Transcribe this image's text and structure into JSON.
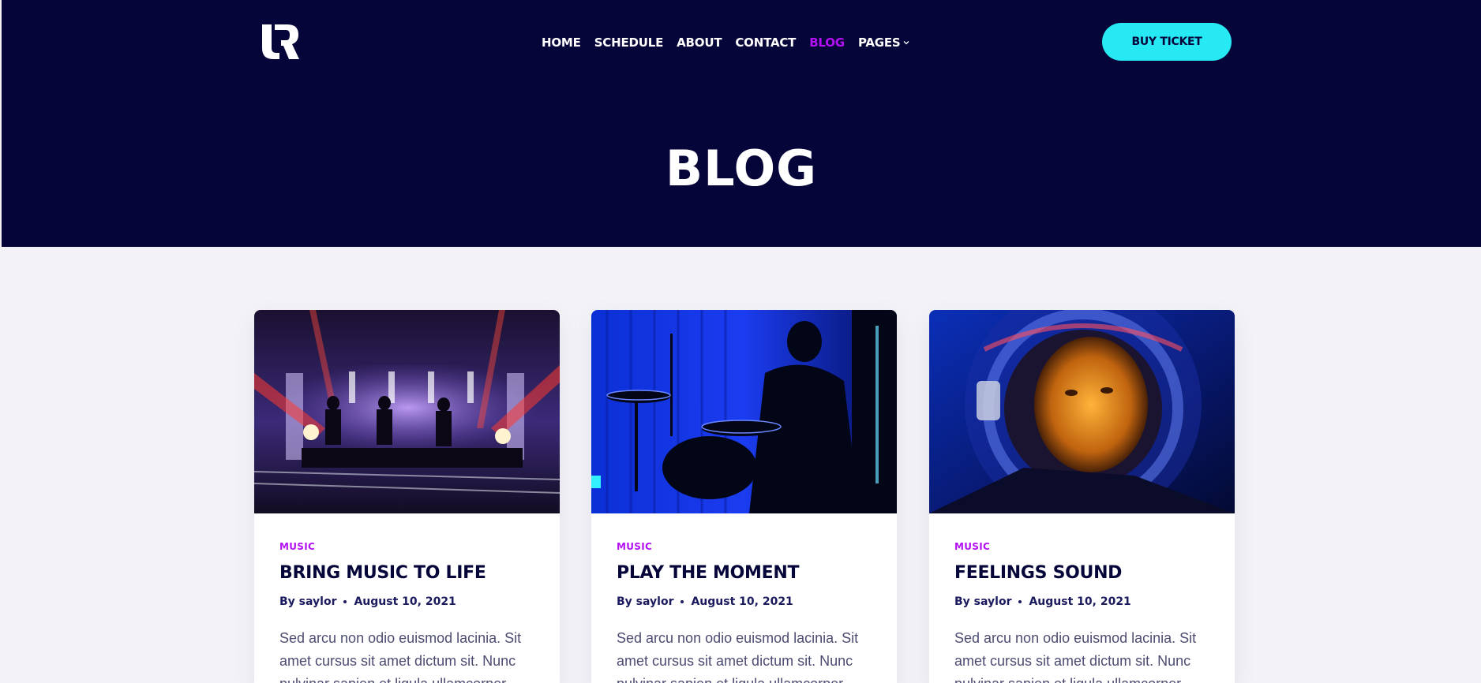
{
  "header": {
    "logo_icon": "brand-logo-icon",
    "nav": [
      {
        "label": "HOME",
        "active": false
      },
      {
        "label": "SCHEDULE",
        "active": false
      },
      {
        "label": "ABOUT",
        "active": false
      },
      {
        "label": "CONTACT",
        "active": false
      },
      {
        "label": "BLOG",
        "active": true
      },
      {
        "label": "PAGES",
        "active": false,
        "has_dropdown": true
      }
    ],
    "cta_label": "BUY TICKET"
  },
  "hero": {
    "title": "BLOG"
  },
  "posts": [
    {
      "image_icon": "concert-stage-photo",
      "category": "MUSIC",
      "title": "BRING MUSIC TO LIFE",
      "author": "By saylor",
      "date": "August 10, 2021",
      "excerpt": "Sed arcu non odio euismod lacinia. Sit amet cursus sit amet dictum sit. Nunc pulvinar sapien et ligula ullamcorper"
    },
    {
      "image_icon": "drummer-photo",
      "category": "MUSIC",
      "title": "PLAY THE MOMENT",
      "author": "By saylor",
      "date": "August 10, 2021",
      "excerpt": "Sed arcu non odio euismod lacinia. Sit amet cursus sit amet dictum sit. Nunc pulvinar sapien et ligula ullamcorper"
    },
    {
      "image_icon": "astronaut-helmet-photo",
      "category": "MUSIC",
      "title": "FEELINGS SOUND",
      "author": "By saylor",
      "date": "August 10, 2021",
      "excerpt": "Sed arcu non odio euismod lacinia. Sit amet cursus sit amet dictum sit. Nunc pulvinar sapien et ligula ullamcorper"
    }
  ],
  "colors": {
    "header_bg": "#06053a",
    "accent_purple": "#b310f4",
    "accent_cyan": "#27e9f3",
    "page_bg": "#f3f3f7"
  }
}
